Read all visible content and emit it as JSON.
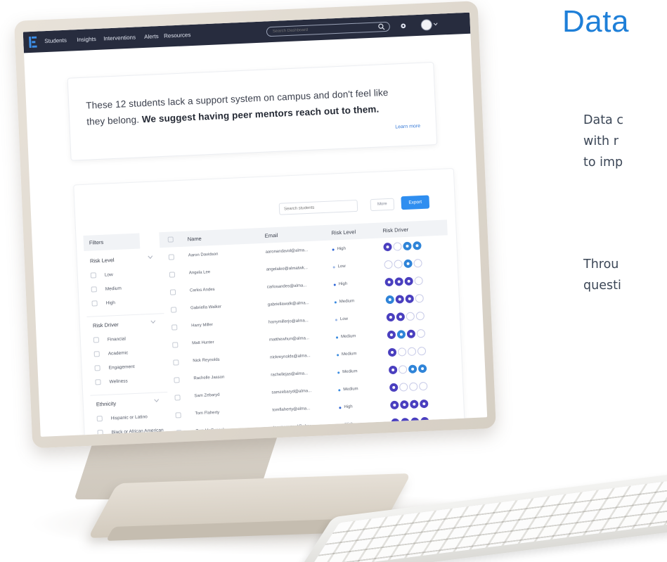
{
  "side": {
    "title": "Data",
    "p1": [
      "Data c",
      "with r",
      "to imp"
    ],
    "p2": [
      "Throu",
      "questi"
    ]
  },
  "nav": {
    "items": [
      "Students",
      "Insights",
      "Interventions",
      "Alerts",
      "Resources"
    ],
    "search_placeholder": "Search Dashboard"
  },
  "banner": {
    "line1": "These 12 students lack a support system on campus and don't feel like",
    "line2_plain": "they belong.",
    "line2_bold": "We suggest having peer mentors reach out to them.",
    "learn_more": "Learn more"
  },
  "toolbar": {
    "search_placeholder": "Search students",
    "more_label": "More",
    "export_label": "Export"
  },
  "filters": {
    "heading": "Filters",
    "groups": [
      {
        "title": "Risk Level",
        "options": [
          "Low",
          "Medium",
          "High"
        ]
      },
      {
        "title": "Risk Driver",
        "options": [
          "Financial",
          "Academic",
          "Engagement",
          "Wellness"
        ]
      },
      {
        "title": "Ethnicity",
        "options": [
          "Hispanic or Latino",
          "Black or African American"
        ]
      }
    ]
  },
  "table": {
    "headers": {
      "name": "Name",
      "email": "Email",
      "risk_level": "Risk Level",
      "risk_driver": "Risk Driver"
    },
    "rows": [
      {
        "name": "Aaron Davidson",
        "email": "aaronandavid@alma...",
        "risk": "High",
        "drivers": [
          1,
          0,
          2,
          2
        ]
      },
      {
        "name": "Angela Lee",
        "email": "angelalee@almatwk...",
        "risk": "Low",
        "drivers": [
          0,
          0,
          2,
          0
        ]
      },
      {
        "name": "Carlos Andes",
        "email": "carlosandes@alma...",
        "risk": "High",
        "drivers": [
          1,
          1,
          1,
          0
        ]
      },
      {
        "name": "Gabriella Walker",
        "email": "gabriellawalk@alma...",
        "risk": "Medium",
        "drivers": [
          2,
          1,
          1,
          0
        ]
      },
      {
        "name": "Harry Miller",
        "email": "harrymillerjo@alma...",
        "risk": "Low",
        "drivers": [
          1,
          1,
          0,
          0
        ]
      },
      {
        "name": "Matt Hunter",
        "email": "matthewhun@alma...",
        "risk": "Medium",
        "drivers": [
          1,
          2,
          1,
          0
        ]
      },
      {
        "name": "Nick Reynolds",
        "email": "nickreynolds@alma...",
        "risk": "Medium",
        "drivers": [
          1,
          0,
          0,
          0
        ]
      },
      {
        "name": "Rachelle Jasson",
        "email": "rachellejas@alma...",
        "risk": "Medium",
        "drivers": [
          1,
          0,
          2,
          2
        ]
      },
      {
        "name": "Sam Zebaryd",
        "email": "samzebaryd@alma...",
        "risk": "Medium",
        "drivers": [
          1,
          0,
          0,
          0
        ]
      },
      {
        "name": "Tom Flaherty",
        "email": "tomflaherty@alma...",
        "risk": "High",
        "drivers": [
          1,
          1,
          1,
          1
        ]
      },
      {
        "name": "Tom McCunnel",
        "email": "tommccunnel@alma...",
        "risk": "High",
        "drivers": [
          1,
          1,
          1,
          1
        ]
      }
    ]
  },
  "colors": {
    "accent": "#2f8ef0",
    "nav_bg": "#272c3e",
    "title_blue": "#1e7fd8",
    "driver_purple": "#4a3fbf",
    "driver_blue": "#2f84d8",
    "risk_high": "#2f66d6",
    "risk_medium": "#3a8be0",
    "risk_low": "#9bb7e6"
  }
}
